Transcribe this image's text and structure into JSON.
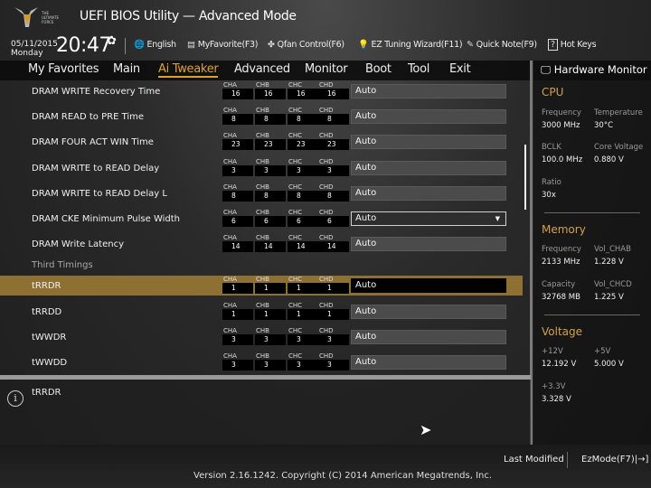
{
  "header": {
    "title": "UEFI BIOS Utility — Advanced Mode",
    "logo_text": "THE ULTIMATE FORCE",
    "date": "05/11/2015",
    "day": "Monday",
    "time": "20:47",
    "tools": [
      {
        "icon": "globe-icon",
        "glyph": "🌐",
        "label": "English"
      },
      {
        "icon": "favorite-icon",
        "glyph": "▤",
        "label": "MyFavorite(F3)"
      },
      {
        "icon": "fan-icon",
        "glyph": "✤",
        "label": "Qfan Control(F6)"
      },
      {
        "icon": "bulb-icon",
        "glyph": "💡",
        "label": "EZ Tuning Wizard(F11)"
      },
      {
        "icon": "note-icon",
        "glyph": "✎",
        "label": "Quick Note(F9)"
      },
      {
        "icon": "help-icon",
        "glyph": "?",
        "label": "Hot Keys"
      }
    ]
  },
  "tabs": [
    "My Favorites",
    "Main",
    "Ai Tweaker",
    "Advanced",
    "Monitor",
    "Boot",
    "Tool",
    "Exit"
  ],
  "active_tab": "Ai Tweaker",
  "channels": [
    "CHA",
    "CHB",
    "CHC",
    "CHD"
  ],
  "rows": [
    {
      "label": "DRAM WRITE Recovery Time",
      "values": [
        "16",
        "16",
        "16",
        "16"
      ],
      "setting": "Auto"
    },
    {
      "label": "DRAM READ to PRE Time",
      "values": [
        "8",
        "8",
        "8",
        "8"
      ],
      "setting": "Auto"
    },
    {
      "label": "DRAM FOUR ACT WIN Time",
      "values": [
        "23",
        "23",
        "23",
        "23"
      ],
      "setting": "Auto"
    },
    {
      "label": "DRAM WRITE to READ Delay",
      "values": [
        "3",
        "3",
        "3",
        "3"
      ],
      "setting": "Auto"
    },
    {
      "label": "DRAM WRITE to READ Delay L",
      "values": [
        "8",
        "8",
        "8",
        "8"
      ],
      "setting": "Auto"
    },
    {
      "label": "DRAM CKE Minimum Pulse Width",
      "values": [
        "6",
        "6",
        "6",
        "6"
      ],
      "setting": "Auto",
      "dropdown": true
    },
    {
      "label": "DRAM Write Latency",
      "values": [
        "14",
        "14",
        "14",
        "14"
      ],
      "setting": "Auto"
    }
  ],
  "section": "Third Timings",
  "rows2": [
    {
      "label": "tRRDR",
      "values": [
        "1",
        "1",
        "1",
        "1"
      ],
      "setting": "Auto",
      "selected": true
    },
    {
      "label": "tRRDD",
      "values": [
        "1",
        "1",
        "1",
        "1"
      ],
      "setting": "Auto"
    },
    {
      "label": "tWWDR",
      "values": [
        "3",
        "3",
        "3",
        "3"
      ],
      "setting": "Auto"
    },
    {
      "label": "tWWDD",
      "values": [
        "3",
        "3",
        "3",
        "3"
      ],
      "setting": "Auto"
    }
  ],
  "info": {
    "text": "tRRDR"
  },
  "hw": {
    "title": "Hardware Monitor",
    "cpu": {
      "title": "CPU",
      "freq_k": "Frequency",
      "freq_v": "3000 MHz",
      "temp_k": "Temperature",
      "temp_v": "30°C",
      "bclk_k": "BCLK",
      "bclk_v": "100.0 MHz",
      "cv_k": "Core Voltage",
      "cv_v": "0.880 V",
      "ratio_k": "Ratio",
      "ratio_v": "30x"
    },
    "mem": {
      "title": "Memory",
      "freq_k": "Frequency",
      "freq_v": "2133 MHz",
      "vab_k": "Vol_CHAB",
      "vab_v": "1.228 V",
      "cap_k": "Capacity",
      "cap_v": "32768 MB",
      "vcd_k": "Vol_CHCD",
      "vcd_v": "1.225 V"
    },
    "volt": {
      "title": "Voltage",
      "v12_k": "+12V",
      "v12_v": "12.192 V",
      "v5_k": "+5V",
      "v5_v": "5.000 V",
      "v33_k": "+3.3V",
      "v33_v": "3.328 V"
    }
  },
  "footer": {
    "last_modified": "Last Modified",
    "ezmode": "EzMode(F7)|→]",
    "version": "Version 2.16.1242. Copyright (C) 2014 American Megatrends, Inc."
  },
  "colors": {
    "accent": "#e0a030",
    "highlight": "#8e7033"
  }
}
